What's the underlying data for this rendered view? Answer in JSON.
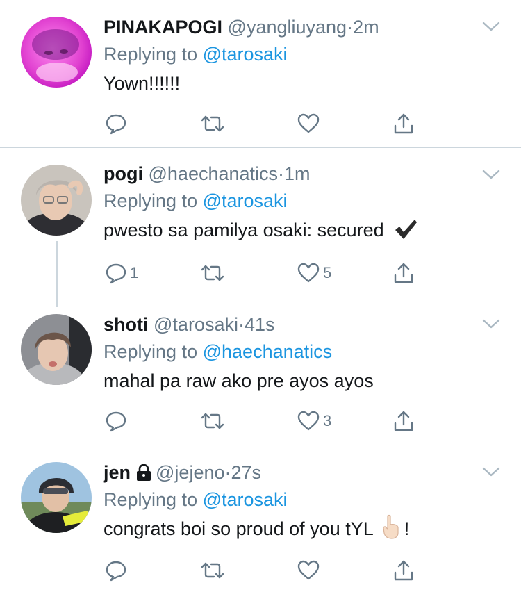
{
  "tweets": [
    {
      "display_name": "PINAKAPOGI",
      "handle": "@yangliuyang",
      "separator": "·",
      "time": "2m",
      "replying_prefix": "Replying to",
      "replying_to": "@tarosaki",
      "text": "Yown!!!!!!",
      "reply_count": "",
      "retweet_count": "",
      "like_count": "",
      "avatar_icon": "avatar-pink"
    },
    {
      "display_name": "pogi",
      "handle": "@haechanatics",
      "separator": "·",
      "time": "1m",
      "replying_prefix": "Replying to",
      "replying_to": "@tarosaki",
      "text": "pwesto sa pamilya osaki: secured",
      "reply_count": "1",
      "retweet_count": "",
      "like_count": "5",
      "avatar_icon": "avatar-grey-hair"
    },
    {
      "display_name": "shoti",
      "handle": "@tarosaki",
      "separator": "·",
      "time": "41s",
      "replying_prefix": "Replying to",
      "replying_to": "@haechanatics",
      "text": "mahal pa raw ako pre ayos ayos",
      "reply_count": "",
      "retweet_count": "",
      "like_count": "3",
      "avatar_icon": "avatar-hoodie"
    },
    {
      "display_name": "jen",
      "handle": "@jejeno",
      "separator": "·",
      "time": "27s",
      "replying_prefix": "Replying to",
      "replying_to": "@tarosaki",
      "text": "congrats boi so proud of you tYL",
      "text_suffix": "!",
      "reply_count": "",
      "retweet_count": "",
      "like_count": "",
      "avatar_icon": "avatar-helmet"
    }
  ],
  "icons": {
    "reply": "speech-bubble-icon",
    "retweet": "retweet-icon",
    "like": "heart-icon",
    "share": "share-icon",
    "more": "chevron-down-icon",
    "protected": "lock-icon"
  },
  "colors": {
    "text": "#14171a",
    "secondary": "#657786",
    "link": "#1b95e0",
    "divider": "#ccd6dd"
  }
}
